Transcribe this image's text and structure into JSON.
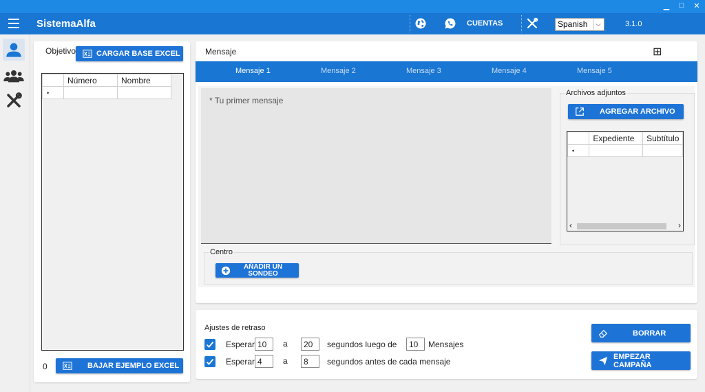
{
  "window": {
    "minimize": "▁",
    "maximize": "□",
    "close": "✕"
  },
  "header": {
    "title": "SistemaAlfa",
    "cuentas_label": "CUENTAS",
    "language": "Spanish",
    "version": "3.1.0"
  },
  "objetivo": {
    "label": "Objetivo",
    "load_button": "CARGAR BASE EXCEL",
    "columns": [
      "Número",
      "Nombre"
    ],
    "new_row_marker": "•",
    "count": "0",
    "download_button": "BAJAR EJEMPLO EXCEL"
  },
  "mensaje": {
    "label": "Mensaje",
    "add_symbol": "⊞",
    "tabs": [
      "Mensaje 1",
      "Mensaje 2",
      "Mensaje 3",
      "Mensaje 4",
      "Mensaje 5"
    ],
    "placeholder": "* Tu primer mensaje",
    "centro_label": "Centro",
    "poll_button": "AÑADIR UN SONDEO"
  },
  "adjuntos": {
    "label": "Archivos adjuntos",
    "add_button": "AGREGAR ARCHIVO",
    "columns": [
      "Expediente",
      "Subtítulo"
    ],
    "new_row_marker": "•",
    "scroll_left": "‹",
    "scroll_right": "›"
  },
  "ajustes": {
    "label": "Ajustes de retraso",
    "row1": {
      "esperar": "Esperar",
      "min": "10",
      "a": "a",
      "max": "20",
      "text": "segundos luego de",
      "count": "10",
      "unit": "Mensajes"
    },
    "row2": {
      "esperar": "Esperar",
      "min": "4",
      "a": "a",
      "max": "8",
      "text": "segundos antes de cada mensaje"
    },
    "clear_button": "BORRAR",
    "start_button": "EMPEZAR CAMPAÑA"
  },
  "colors": {
    "primary": "#1976d2",
    "button": "#1e74d6"
  }
}
